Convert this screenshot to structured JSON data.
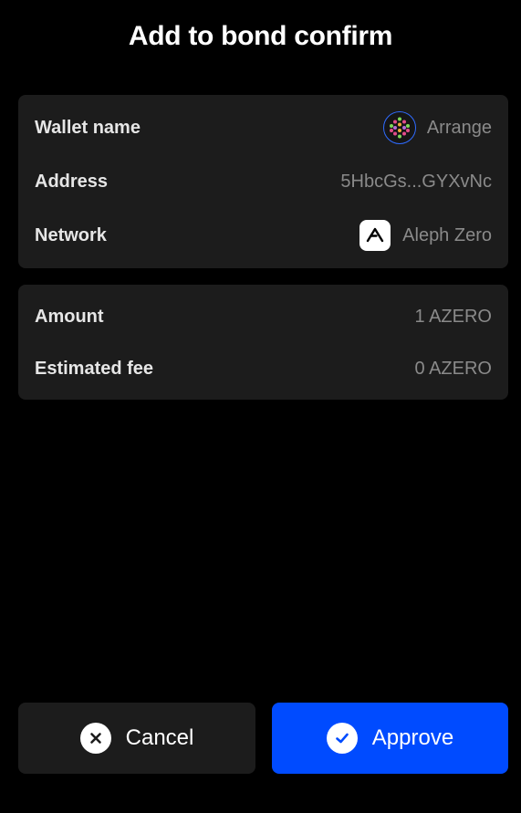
{
  "header": {
    "title": "Add to bond confirm"
  },
  "account_card": {
    "wallet_name_label": "Wallet name",
    "wallet_name_value": "Arrange",
    "address_label": "Address",
    "address_value": "5HbcGs...GYXvNc",
    "network_label": "Network",
    "network_value": "Aleph Zero",
    "wallet_icon": "wallet-identicon",
    "network_icon": "aleph-zero-logo"
  },
  "amount_card": {
    "amount_label": "Amount",
    "amount_value": "1 AZERO",
    "fee_label": "Estimated fee",
    "fee_value": "0 AZERO"
  },
  "actions": {
    "cancel_label": "Cancel",
    "cancel_icon": "close-icon",
    "approve_label": "Approve",
    "approve_icon": "check-icon"
  },
  "colors": {
    "background": "#000000",
    "card": "#1c1c1c",
    "primary": "#004bff",
    "muted_text": "#8a8a8a"
  }
}
